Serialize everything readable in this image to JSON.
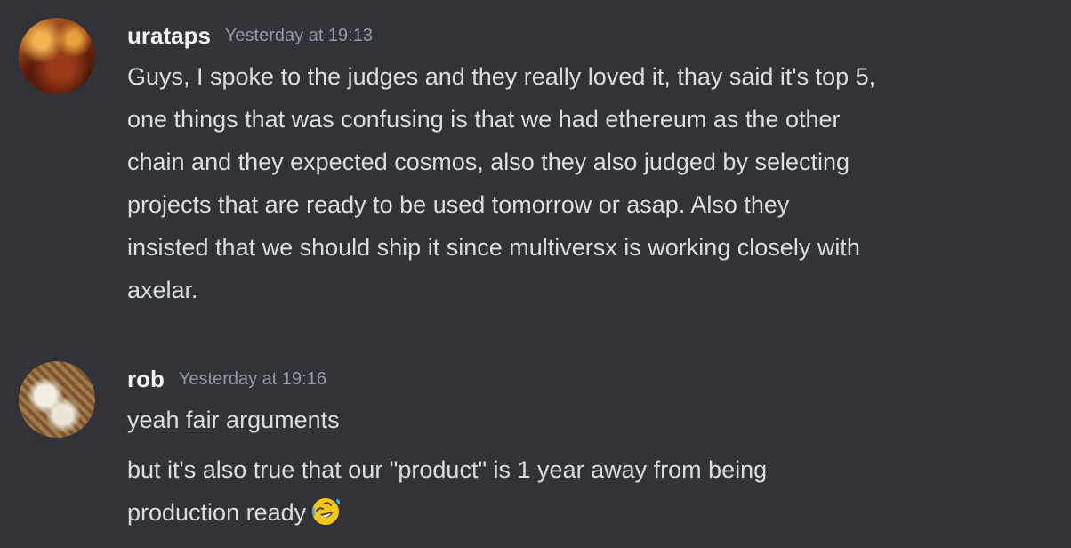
{
  "messages": [
    {
      "username": "urataps",
      "timestamp": "Yesterday at 19:13",
      "lines": [
        "Guys, I spoke to the judges and they really loved it, thay said it's top 5,",
        "one things that was confusing is that we had ethereum as the other",
        "chain and they expected cosmos, also they also judged by selecting",
        "projects that are ready to be used tomorrow or asap. Also they",
        "insisted that we should ship it since multiversx is working closely with",
        "axelar."
      ]
    },
    {
      "username": "rob",
      "timestamp": "Yesterday at 19:16",
      "lines": [
        "yeah fair arguments"
      ],
      "lines_2": [
        "but it's also true that our \"product\" is 1 year away from being",
        "production ready"
      ],
      "emoji": "rolling-on-the-floor-laughing-emoji"
    }
  ]
}
